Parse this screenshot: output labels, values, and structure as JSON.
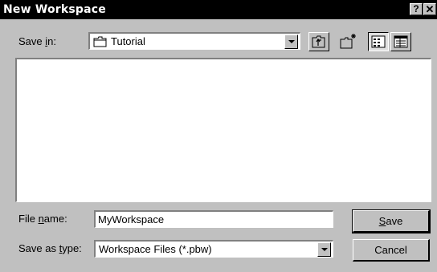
{
  "window": {
    "title": "New Workspace",
    "help_label": "?",
    "close_label": "✕"
  },
  "save_in": {
    "label_pre": "Save ",
    "label_ul": "i",
    "label_post": "n:",
    "value": "Tutorial"
  },
  "toolbar": {
    "icons": [
      "up-folder-icon",
      "new-folder-icon",
      "list-view-icon",
      "details-view-icon"
    ]
  },
  "file_name": {
    "label_pre": "File ",
    "label_ul": "n",
    "label_post": "ame:",
    "value": "MyWorkspace"
  },
  "save_as_type": {
    "label_pre": "Save as ",
    "label_ul": "t",
    "label_post": "ype:",
    "value": "Workspace Files (*.pbw)"
  },
  "buttons": {
    "save_ul": "S",
    "save_rest": "ave",
    "cancel": "Cancel"
  }
}
